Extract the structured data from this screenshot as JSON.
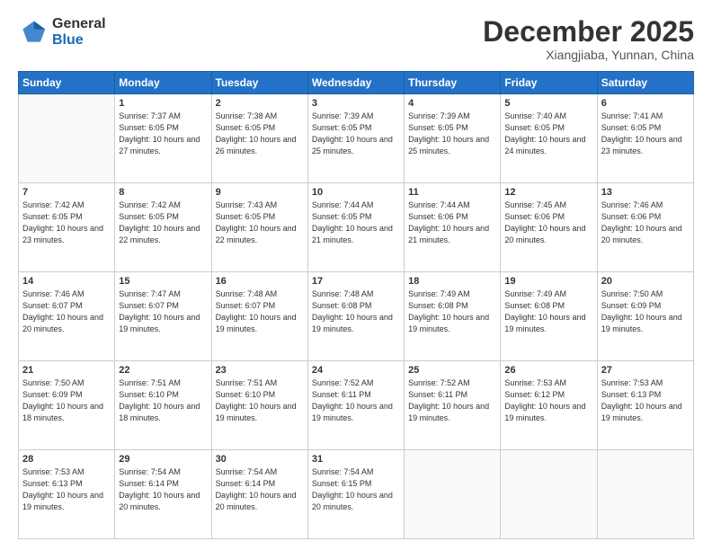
{
  "logo": {
    "general": "General",
    "blue": "Blue"
  },
  "header": {
    "title": "December 2025",
    "subtitle": "Xiangjiaba, Yunnan, China"
  },
  "weekdays": [
    "Sunday",
    "Monday",
    "Tuesday",
    "Wednesday",
    "Thursday",
    "Friday",
    "Saturday"
  ],
  "weeks": [
    [
      {
        "day": "",
        "empty": true
      },
      {
        "day": "1",
        "sunrise": "Sunrise: 7:37 AM",
        "sunset": "Sunset: 6:05 PM",
        "daylight": "Daylight: 10 hours and 27 minutes."
      },
      {
        "day": "2",
        "sunrise": "Sunrise: 7:38 AM",
        "sunset": "Sunset: 6:05 PM",
        "daylight": "Daylight: 10 hours and 26 minutes."
      },
      {
        "day": "3",
        "sunrise": "Sunrise: 7:39 AM",
        "sunset": "Sunset: 6:05 PM",
        "daylight": "Daylight: 10 hours and 25 minutes."
      },
      {
        "day": "4",
        "sunrise": "Sunrise: 7:39 AM",
        "sunset": "Sunset: 6:05 PM",
        "daylight": "Daylight: 10 hours and 25 minutes."
      },
      {
        "day": "5",
        "sunrise": "Sunrise: 7:40 AM",
        "sunset": "Sunset: 6:05 PM",
        "daylight": "Daylight: 10 hours and 24 minutes."
      },
      {
        "day": "6",
        "sunrise": "Sunrise: 7:41 AM",
        "sunset": "Sunset: 6:05 PM",
        "daylight": "Daylight: 10 hours and 23 minutes."
      }
    ],
    [
      {
        "day": "7",
        "sunrise": "Sunrise: 7:42 AM",
        "sunset": "Sunset: 6:05 PM",
        "daylight": "Daylight: 10 hours and 23 minutes."
      },
      {
        "day": "8",
        "sunrise": "Sunrise: 7:42 AM",
        "sunset": "Sunset: 6:05 PM",
        "daylight": "Daylight: 10 hours and 22 minutes."
      },
      {
        "day": "9",
        "sunrise": "Sunrise: 7:43 AM",
        "sunset": "Sunset: 6:05 PM",
        "daylight": "Daylight: 10 hours and 22 minutes."
      },
      {
        "day": "10",
        "sunrise": "Sunrise: 7:44 AM",
        "sunset": "Sunset: 6:05 PM",
        "daylight": "Daylight: 10 hours and 21 minutes."
      },
      {
        "day": "11",
        "sunrise": "Sunrise: 7:44 AM",
        "sunset": "Sunset: 6:06 PM",
        "daylight": "Daylight: 10 hours and 21 minutes."
      },
      {
        "day": "12",
        "sunrise": "Sunrise: 7:45 AM",
        "sunset": "Sunset: 6:06 PM",
        "daylight": "Daylight: 10 hours and 20 minutes."
      },
      {
        "day": "13",
        "sunrise": "Sunrise: 7:46 AM",
        "sunset": "Sunset: 6:06 PM",
        "daylight": "Daylight: 10 hours and 20 minutes."
      }
    ],
    [
      {
        "day": "14",
        "sunrise": "Sunrise: 7:46 AM",
        "sunset": "Sunset: 6:07 PM",
        "daylight": "Daylight: 10 hours and 20 minutes."
      },
      {
        "day": "15",
        "sunrise": "Sunrise: 7:47 AM",
        "sunset": "Sunset: 6:07 PM",
        "daylight": "Daylight: 10 hours and 19 minutes."
      },
      {
        "day": "16",
        "sunrise": "Sunrise: 7:48 AM",
        "sunset": "Sunset: 6:07 PM",
        "daylight": "Daylight: 10 hours and 19 minutes."
      },
      {
        "day": "17",
        "sunrise": "Sunrise: 7:48 AM",
        "sunset": "Sunset: 6:08 PM",
        "daylight": "Daylight: 10 hours and 19 minutes."
      },
      {
        "day": "18",
        "sunrise": "Sunrise: 7:49 AM",
        "sunset": "Sunset: 6:08 PM",
        "daylight": "Daylight: 10 hours and 19 minutes."
      },
      {
        "day": "19",
        "sunrise": "Sunrise: 7:49 AM",
        "sunset": "Sunset: 6:08 PM",
        "daylight": "Daylight: 10 hours and 19 minutes."
      },
      {
        "day": "20",
        "sunrise": "Sunrise: 7:50 AM",
        "sunset": "Sunset: 6:09 PM",
        "daylight": "Daylight: 10 hours and 19 minutes."
      }
    ],
    [
      {
        "day": "21",
        "sunrise": "Sunrise: 7:50 AM",
        "sunset": "Sunset: 6:09 PM",
        "daylight": "Daylight: 10 hours and 18 minutes."
      },
      {
        "day": "22",
        "sunrise": "Sunrise: 7:51 AM",
        "sunset": "Sunset: 6:10 PM",
        "daylight": "Daylight: 10 hours and 18 minutes."
      },
      {
        "day": "23",
        "sunrise": "Sunrise: 7:51 AM",
        "sunset": "Sunset: 6:10 PM",
        "daylight": "Daylight: 10 hours and 19 minutes."
      },
      {
        "day": "24",
        "sunrise": "Sunrise: 7:52 AM",
        "sunset": "Sunset: 6:11 PM",
        "daylight": "Daylight: 10 hours and 19 minutes."
      },
      {
        "day": "25",
        "sunrise": "Sunrise: 7:52 AM",
        "sunset": "Sunset: 6:11 PM",
        "daylight": "Daylight: 10 hours and 19 minutes."
      },
      {
        "day": "26",
        "sunrise": "Sunrise: 7:53 AM",
        "sunset": "Sunset: 6:12 PM",
        "daylight": "Daylight: 10 hours and 19 minutes."
      },
      {
        "day": "27",
        "sunrise": "Sunrise: 7:53 AM",
        "sunset": "Sunset: 6:13 PM",
        "daylight": "Daylight: 10 hours and 19 minutes."
      }
    ],
    [
      {
        "day": "28",
        "sunrise": "Sunrise: 7:53 AM",
        "sunset": "Sunset: 6:13 PM",
        "daylight": "Daylight: 10 hours and 19 minutes."
      },
      {
        "day": "29",
        "sunrise": "Sunrise: 7:54 AM",
        "sunset": "Sunset: 6:14 PM",
        "daylight": "Daylight: 10 hours and 20 minutes."
      },
      {
        "day": "30",
        "sunrise": "Sunrise: 7:54 AM",
        "sunset": "Sunset: 6:14 PM",
        "daylight": "Daylight: 10 hours and 20 minutes."
      },
      {
        "day": "31",
        "sunrise": "Sunrise: 7:54 AM",
        "sunset": "Sunset: 6:15 PM",
        "daylight": "Daylight: 10 hours and 20 minutes."
      },
      {
        "day": "",
        "empty": true
      },
      {
        "day": "",
        "empty": true
      },
      {
        "day": "",
        "empty": true
      }
    ]
  ]
}
